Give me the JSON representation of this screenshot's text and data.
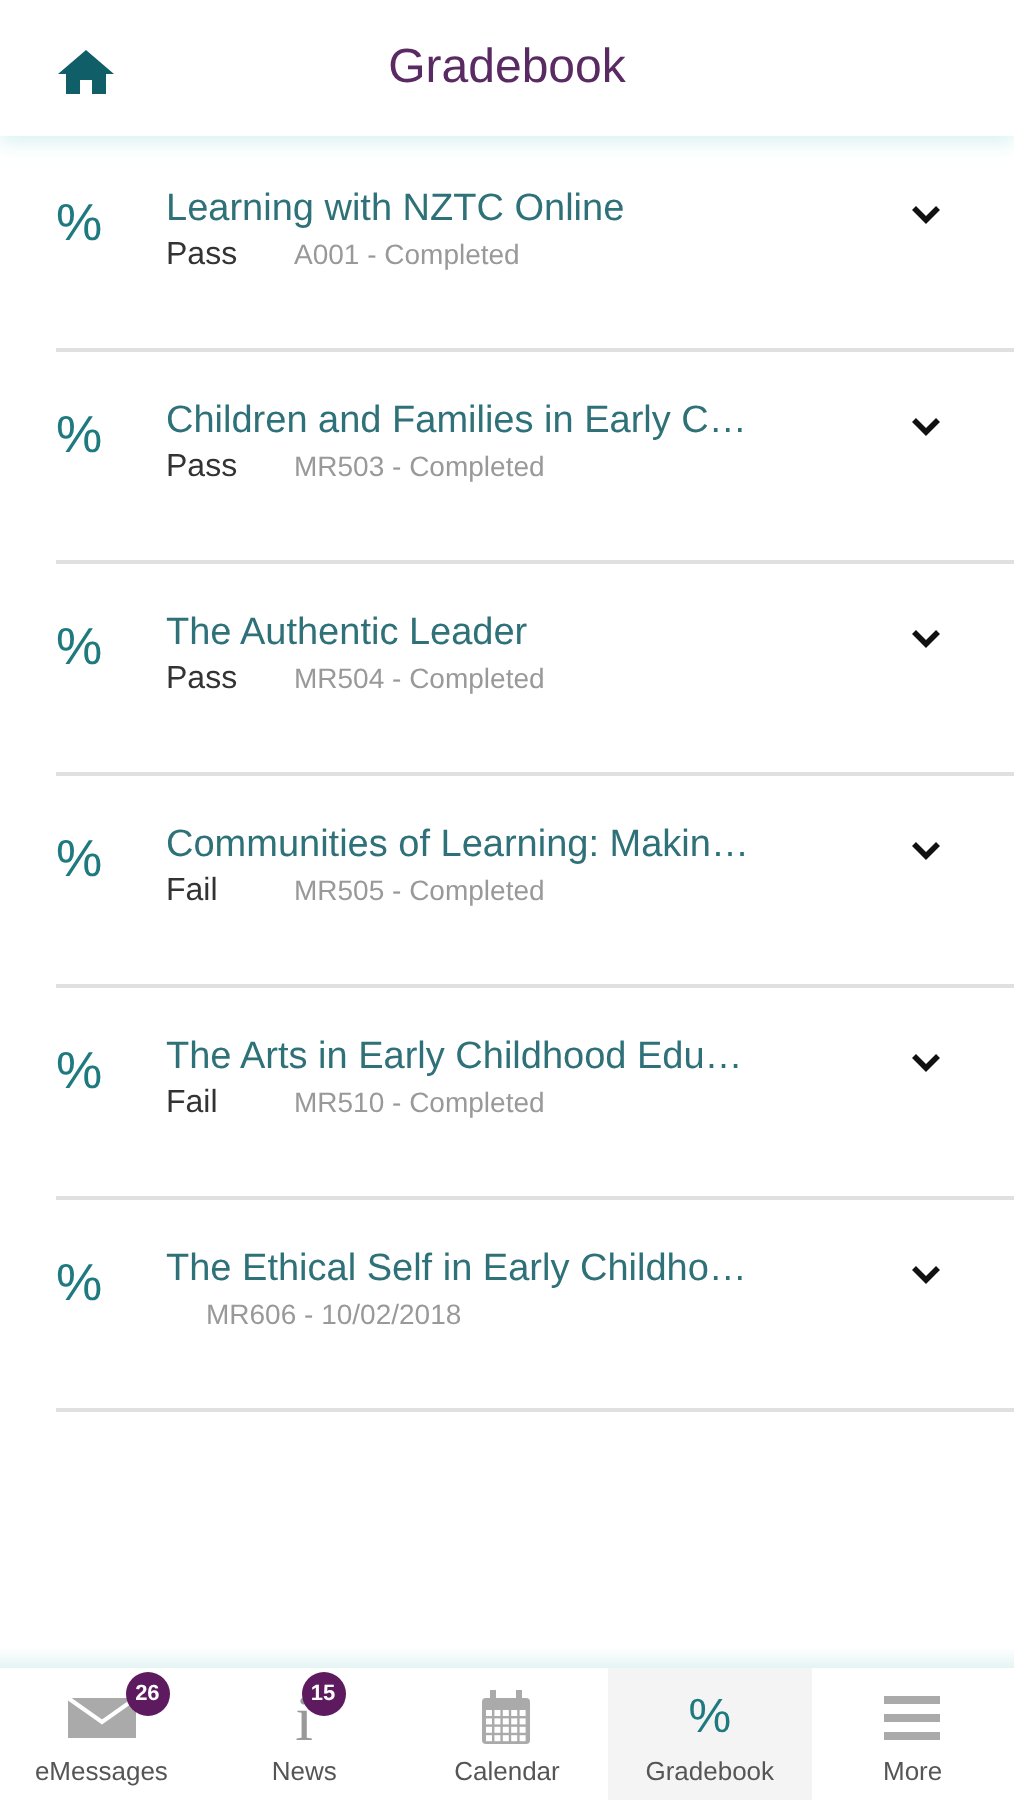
{
  "header": {
    "title": "Gradebook"
  },
  "courses": [
    {
      "icon": "%",
      "title": "Learning with NZTC Online",
      "result": "Pass",
      "detail": "A001 - Completed"
    },
    {
      "icon": "%",
      "title": "Children and Families in Early C…",
      "result": "Pass",
      "detail": "MR503 - Completed"
    },
    {
      "icon": "%",
      "title": "The Authentic Leader",
      "result": "Pass",
      "detail": "MR504 - Completed"
    },
    {
      "icon": "%",
      "title": "Communities of Learning: Makin…",
      "result": "Fail",
      "detail": "MR505 - Completed"
    },
    {
      "icon": "%",
      "title": "The Arts in Early Childhood Edu…",
      "result": "Fail",
      "detail": "MR510 - Completed"
    },
    {
      "icon": "%",
      "title": "The Ethical Self in Early Childho…",
      "detail": "MR606 - 10/02/2018"
    }
  ],
  "tabs": [
    {
      "kind": "mail",
      "label": "eMessages",
      "badge": "26",
      "selected": false
    },
    {
      "kind": "info",
      "glyph": "i",
      "label": "News",
      "badge": "15",
      "selected": false
    },
    {
      "kind": "calendar",
      "label": "Calendar",
      "selected": false
    },
    {
      "kind": "glyph",
      "glyph": "%",
      "label": "Gradebook",
      "selected": true
    },
    {
      "kind": "menu",
      "label": "More",
      "selected": false
    }
  ]
}
